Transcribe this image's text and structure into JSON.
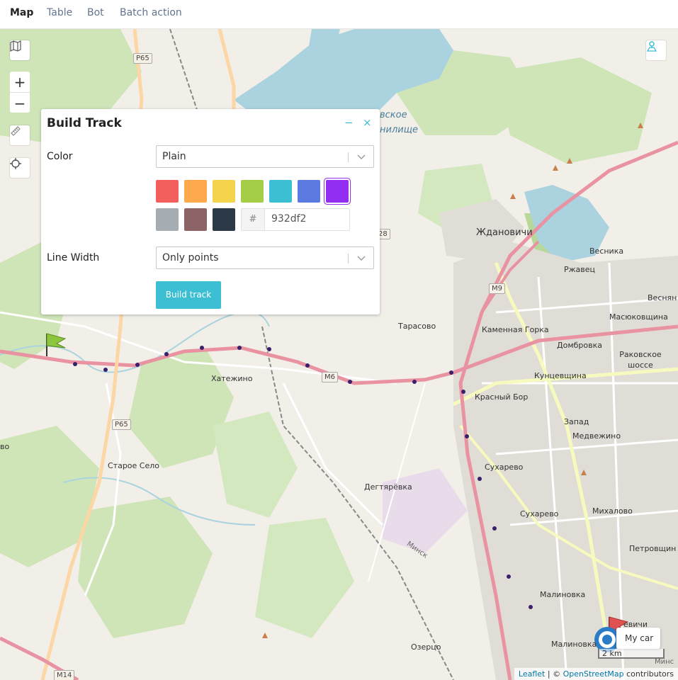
{
  "nav": {
    "tabs": [
      {
        "label": "Map",
        "active": true
      },
      {
        "label": "Table",
        "active": false
      },
      {
        "label": "Bot",
        "active": false
      },
      {
        "label": "Batch action",
        "active": false
      }
    ]
  },
  "map_controls": {
    "zoom_in": "+",
    "zoom_out": "−",
    "layers_icon": "map-icon",
    "ruler_icon": "ruler-icon",
    "locate_icon": "crosshair-icon",
    "route_icon": "route-icon"
  },
  "panel": {
    "title": "Build Track",
    "minimize": "−",
    "close": "×",
    "color_label": "Color",
    "color_value": "Plain",
    "palette": [
      "#f25f5c",
      "#ffa94d",
      "#f4d44d",
      "#a5cd45",
      "#3cbfd2",
      "#5b7be0",
      "#932df2",
      "#a5adb2",
      "#8d6466",
      "#2c3a48"
    ],
    "selected_color": "#932df2",
    "hash": "#",
    "hex_value": "932df2",
    "line_width_label": "Line Width",
    "line_width_value": "Only points",
    "build_button": "Build track"
  },
  "map": {
    "places": [
      {
        "name": "Ждановичи"
      },
      {
        "name": "Тарасово"
      },
      {
        "name": "Хатежино"
      },
      {
        "name": "Каменная Горка"
      },
      {
        "name": "Домбровка"
      },
      {
        "name": "Кунцевщина"
      },
      {
        "name": "Красный Бор"
      },
      {
        "name": "Запад"
      },
      {
        "name": "Медвежино"
      },
      {
        "name": "Сухарево"
      },
      {
        "name": "Сухарево"
      },
      {
        "name": "Михалово"
      },
      {
        "name": "Петровщин"
      },
      {
        "name": "Малиновка"
      },
      {
        "name": "Малиновка"
      },
      {
        "name": "Дегтярёвка"
      },
      {
        "name": "Старое Село"
      },
      {
        "name": "Озерцо"
      },
      {
        "name": "Весника"
      },
      {
        "name": "Ржавец"
      },
      {
        "name": "Веснян"
      },
      {
        "name": "Масюковщина"
      },
      {
        "name": "Раковское шоссе"
      },
      {
        "name": "вское"
      },
      {
        "name": "нилище"
      },
      {
        "name": "Минск"
      },
      {
        "name": "во"
      },
      {
        "name": "евичи"
      },
      {
        "name": "Минс"
      }
    ],
    "road_labels": [
      "P65",
      "P65",
      "M6",
      "M9",
      "28",
      "M14"
    ],
    "track_color": "#932df2",
    "flag_a": "A",
    "flag_b": "B",
    "car_label": "My car",
    "scale": "2 km",
    "attribution": {
      "leaflet": "Leaflet",
      "sep": " | © ",
      "osm": "OpenStreetMap",
      "suffix": " contributors"
    }
  }
}
